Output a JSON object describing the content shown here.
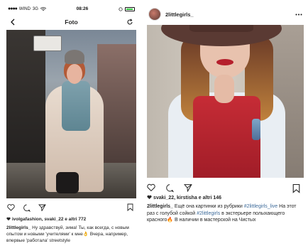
{
  "left_phone": {
    "status_bar": {
      "signal": "●●●●",
      "carrier": "WIND",
      "network": "3G",
      "time": "08:26"
    },
    "nav": {
      "title": "Foto"
    },
    "post": {
      "likes": "ivolgafashion, svaki_22 e altri 772",
      "caption_user": "2littlegirls_",
      "caption_text": " Ну здравствуй, зима! Ты, как всегда, с новым опытом и новыми 'учителями' к мне👌 Вчера, например, впервые 'работала' streetstyle"
    },
    "icons": [
      "back-icon",
      "refresh-icon",
      "heart-icon",
      "comment-icon",
      "share-icon",
      "bookmark-icon"
    ]
  },
  "right_post": {
    "username": "2littlegirls_",
    "likes": "svaki_22, kirstisha e altri 146",
    "caption": {
      "user": "2littlegirls_",
      "t1": " Ещё она картинки из рубрики ",
      "h1": "#2littlegirls_live",
      "t2": " На этот раз с голубой сойкой ",
      "h2": "#2littlegirls",
      "t3": " в экстерьере полыхающего красного🔥 В наличии в мастерской на Чистых"
    },
    "icons": [
      "more-icon",
      "heart-icon",
      "comment-icon",
      "share-icon",
      "bookmark-icon"
    ]
  },
  "colors": {
    "hashtag": "#3e6b9a",
    "text": "#262626",
    "battery": "#2fbf3c"
  }
}
